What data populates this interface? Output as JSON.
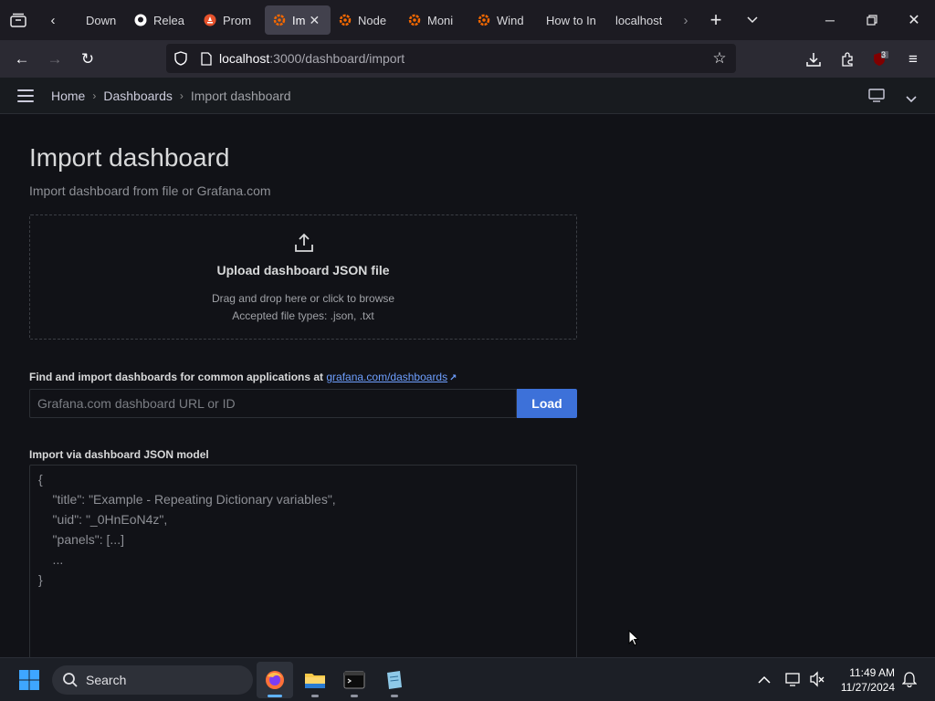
{
  "browser": {
    "tabs": [
      {
        "title": "Down",
        "favicon": "download-icon",
        "active": false
      },
      {
        "title": "Relea",
        "favicon": "github-icon",
        "active": false
      },
      {
        "title": "Prom",
        "favicon": "prometheus-icon",
        "active": false
      },
      {
        "title": "Im",
        "favicon": "grafana-icon",
        "active": true
      },
      {
        "title": "Node",
        "favicon": "grafana-icon",
        "active": false
      },
      {
        "title": "Moni",
        "favicon": "grafana-icon",
        "active": false
      },
      {
        "title": "Wind",
        "favicon": "grafana-icon",
        "active": false
      },
      {
        "title": "How to In",
        "favicon": "",
        "active": false
      },
      {
        "title": "localhost",
        "favicon": "",
        "active": false
      }
    ],
    "url_host": "localhost",
    "url_path": ":3000/dashboard/import",
    "extension_badge": "3"
  },
  "grafana": {
    "breadcrumbs": [
      "Home",
      "Dashboards",
      "Import dashboard"
    ],
    "page_title": "Import dashboard",
    "page_subtitle": "Import dashboard from file or Grafana.com",
    "upload": {
      "title": "Upload dashboard JSON file",
      "hint": "Drag and drop here or click to browse",
      "types": "Accepted file types: .json, .txt"
    },
    "find": {
      "label": "Find and import dashboards for common applications at ",
      "link": "grafana.com/dashboards",
      "placeholder": "Grafana.com dashboard URL or ID",
      "button": "Load"
    },
    "json_model": {
      "label": "Import via dashboard JSON model",
      "lines": [
        "{",
        "    \"title\": \"Example - Repeating Dictionary variables\",",
        "    \"uid\": \"_0HnEoN4z\",",
        "    \"panels\": [...]",
        "    ...",
        "}"
      ]
    }
  },
  "taskbar": {
    "search_label": "Search",
    "time": "11:49 AM",
    "date": "11/27/2024"
  }
}
